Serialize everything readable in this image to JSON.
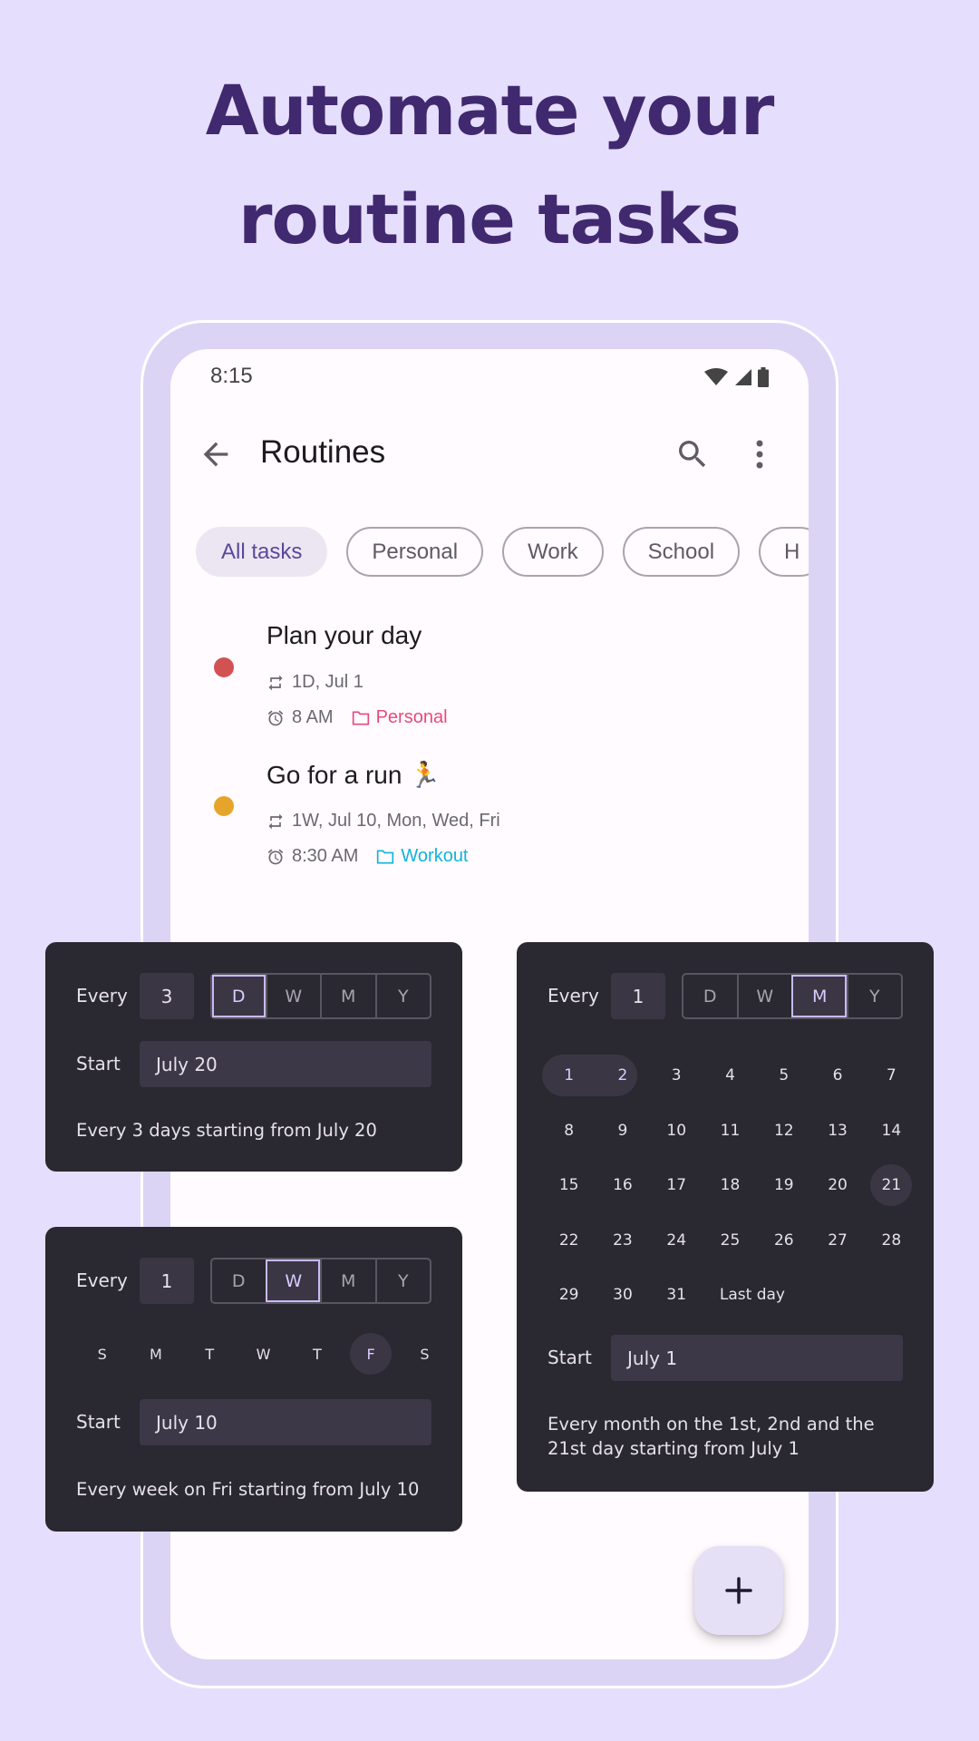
{
  "headline": {
    "line1": "Automate your",
    "line2": "routine tasks"
  },
  "status_bar": {
    "time": "8:15",
    "icons": [
      "wifi-icon",
      "cell-signal-icon",
      "battery-icon"
    ]
  },
  "toolbar": {
    "title": "Routines",
    "back_icon": "arrow-back-icon",
    "search_icon": "search-icon",
    "more_icon": "more-vert-icon"
  },
  "chips": [
    {
      "label": "All tasks",
      "active": true
    },
    {
      "label": "Personal",
      "active": false
    },
    {
      "label": "Work",
      "active": false
    },
    {
      "label": "School",
      "active": false
    },
    {
      "label": "H",
      "active": false
    }
  ],
  "tasks": [
    {
      "title": "Plan your day",
      "dot_color": "#d25253",
      "repeat": "1D, Jul 1",
      "time": "8 AM",
      "category": "Personal",
      "category_color": "#e64b7a"
    },
    {
      "title": "Go for a run 🏃",
      "dot_color": "#e6a52a",
      "repeat": "1W, Jul 10, Mon, Wed, Fri",
      "time": "8:30 AM",
      "category": "Workout",
      "category_color": "#12b3de"
    }
  ],
  "fab": {
    "icon": "plus-icon"
  },
  "panel_daily": {
    "every_label": "Every",
    "every_value": "3",
    "units": [
      "D",
      "W",
      "M",
      "Y"
    ],
    "selected_unit": "D",
    "start_label": "Start",
    "start_value": "July 20",
    "summary": "Every 3 days starting from July 20"
  },
  "panel_weekly": {
    "every_label": "Every",
    "every_value": "1",
    "units": [
      "D",
      "W",
      "M",
      "Y"
    ],
    "selected_unit": "W",
    "weekdays": [
      "S",
      "M",
      "T",
      "W",
      "T",
      "F",
      "S"
    ],
    "selected_weekdays": [
      5
    ],
    "start_label": "Start",
    "start_value": "July 10",
    "summary": "Every week on Fri starting from July 10"
  },
  "panel_monthly": {
    "every_label": "Every",
    "every_value": "1",
    "units": [
      "D",
      "W",
      "M",
      "Y"
    ],
    "selected_unit": "M",
    "days": [
      "1",
      "2",
      "3",
      "4",
      "5",
      "6",
      "7",
      "8",
      "9",
      "10",
      "11",
      "12",
      "13",
      "14",
      "15",
      "16",
      "17",
      "18",
      "19",
      "20",
      "21",
      "22",
      "23",
      "24",
      "25",
      "26",
      "27",
      "28",
      "29",
      "30",
      "31"
    ],
    "last_day_label": "Last day",
    "selected_days": [
      "1",
      "2",
      "21"
    ],
    "start_label": "Start",
    "start_value": "July 1",
    "summary": "Every month on the 1st, 2nd and the 21st day starting from July 1"
  }
}
